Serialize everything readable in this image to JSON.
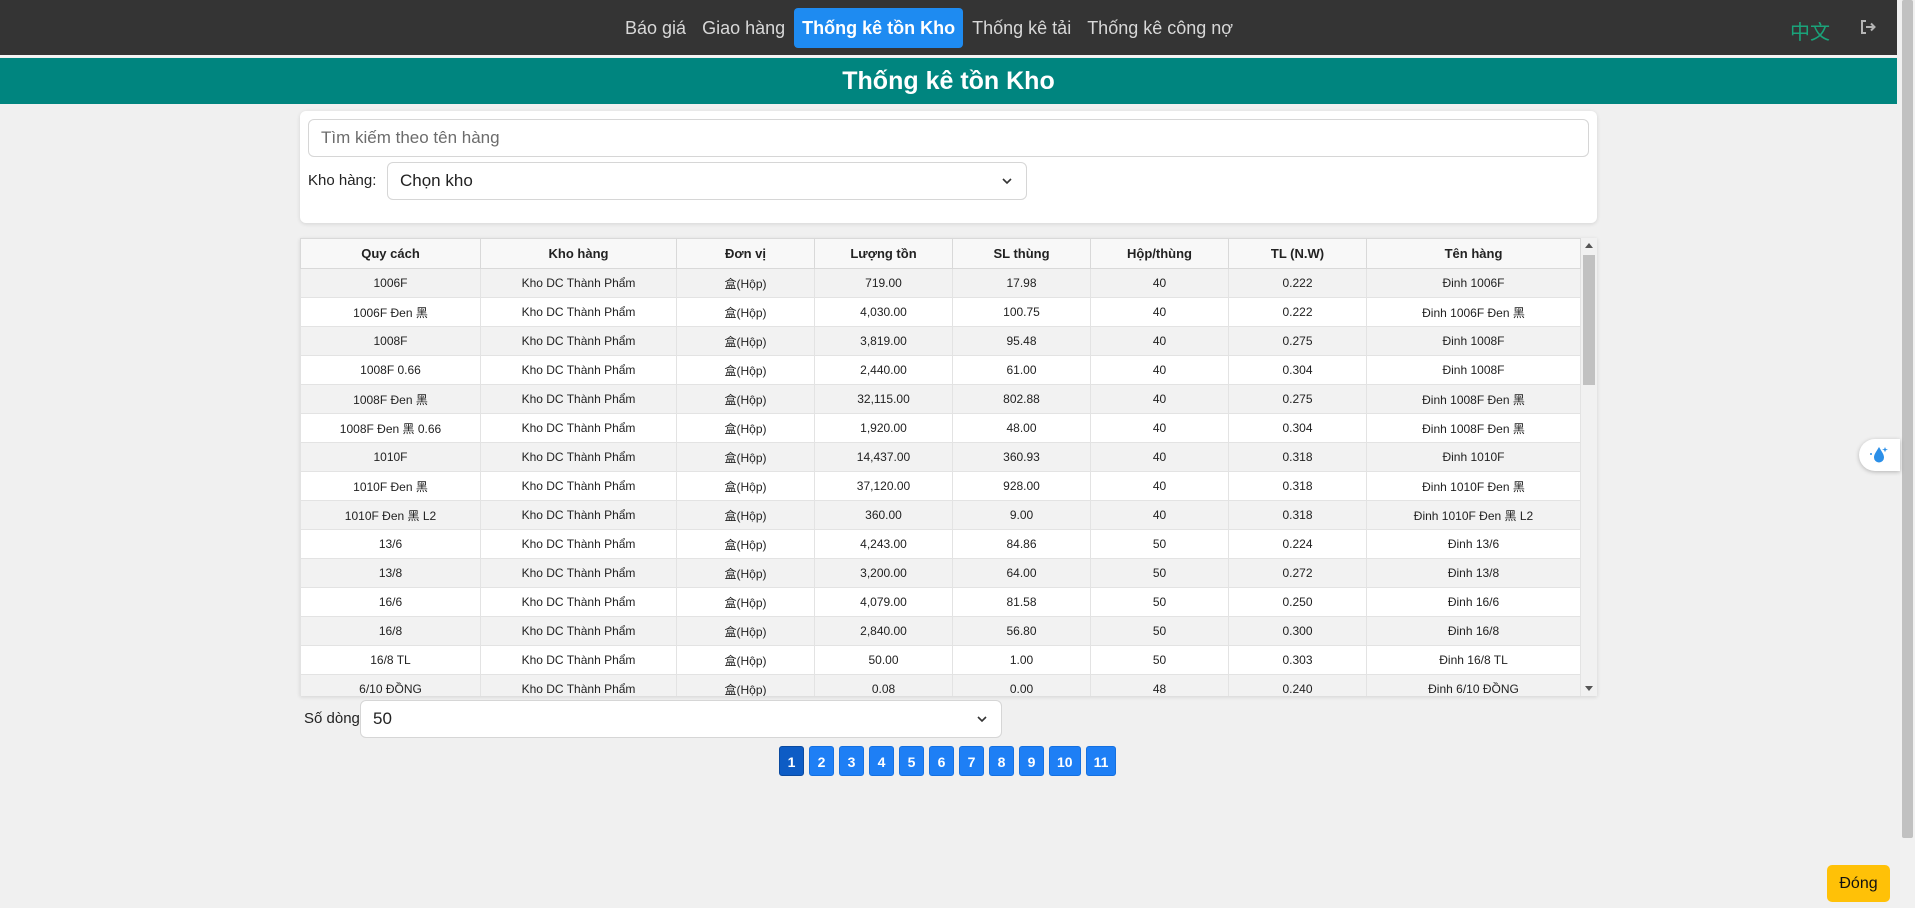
{
  "nav": {
    "items": [
      {
        "label": "Báo giá",
        "active": false
      },
      {
        "label": "Giao hàng",
        "active": false
      },
      {
        "label": "Thống kê tồn Kho",
        "active": true
      },
      {
        "label": "Thống kê tải",
        "active": false
      },
      {
        "label": "Thống kê công nợ",
        "active": false
      }
    ],
    "language": "中文",
    "logout_icon": "sign-out-icon"
  },
  "page_title": "Thống kê tồn Kho",
  "filters": {
    "search_placeholder": "Tìm kiếm theo tên hàng",
    "warehouse_label": "Kho hàng:",
    "warehouse_value": "Chọn kho"
  },
  "table": {
    "columns": [
      "Quy cách",
      "Kho hàng",
      "Đơn vị",
      "Lượng tồn",
      "SL thùng",
      "Hộp/thùng",
      "TL (N.W)",
      "Tên hàng"
    ],
    "rows": [
      [
        "1006F",
        "Kho DC Thành Phẩm",
        "盒(Hộp)",
        "719.00",
        "17.98",
        "40",
        "0.222",
        "Đinh 1006F"
      ],
      [
        "1006F Đen 黑",
        "Kho DC Thành Phẩm",
        "盒(Hộp)",
        "4,030.00",
        "100.75",
        "40",
        "0.222",
        "Đinh 1006F Đen 黑"
      ],
      [
        "1008F",
        "Kho DC Thành Phẩm",
        "盒(Hộp)",
        "3,819.00",
        "95.48",
        "40",
        "0.275",
        "Đinh 1008F"
      ],
      [
        "1008F 0.66",
        "Kho DC Thành Phẩm",
        "盒(Hộp)",
        "2,440.00",
        "61.00",
        "40",
        "0.304",
        "Đinh 1008F"
      ],
      [
        "1008F Đen 黑",
        "Kho DC Thành Phẩm",
        "盒(Hộp)",
        "32,115.00",
        "802.88",
        "40",
        "0.275",
        "Đinh 1008F Đen 黑"
      ],
      [
        "1008F Đen 黑 0.66",
        "Kho DC Thành Phẩm",
        "盒(Hộp)",
        "1,920.00",
        "48.00",
        "40",
        "0.304",
        "Đinh 1008F Đen 黑"
      ],
      [
        "1010F",
        "Kho DC Thành Phẩm",
        "盒(Hộp)",
        "14,437.00",
        "360.93",
        "40",
        "0.318",
        "Đinh 1010F"
      ],
      [
        "1010F Đen 黑",
        "Kho DC Thành Phẩm",
        "盒(Hộp)",
        "37,120.00",
        "928.00",
        "40",
        "0.318",
        "Đinh 1010F Đen 黑"
      ],
      [
        "1010F Đen 黑 L2",
        "Kho DC Thành Phẩm",
        "盒(Hộp)",
        "360.00",
        "9.00",
        "40",
        "0.318",
        "Đinh 1010F Đen 黑 L2"
      ],
      [
        "13/6",
        "Kho DC Thành Phẩm",
        "盒(Hộp)",
        "4,243.00",
        "84.86",
        "50",
        "0.224",
        "Đinh 13/6"
      ],
      [
        "13/8",
        "Kho DC Thành Phẩm",
        "盒(Hộp)",
        "3,200.00",
        "64.00",
        "50",
        "0.272",
        "Đinh 13/8"
      ],
      [
        "16/6",
        "Kho DC Thành Phẩm",
        "盒(Hộp)",
        "4,079.00",
        "81.58",
        "50",
        "0.250",
        "Đinh 16/6"
      ],
      [
        "16/8",
        "Kho DC Thành Phẩm",
        "盒(Hộp)",
        "2,840.00",
        "56.80",
        "50",
        "0.300",
        "Đinh 16/8"
      ],
      [
        "16/8 TL",
        "Kho DC Thành Phẩm",
        "盒(Hộp)",
        "50.00",
        "1.00",
        "50",
        "0.303",
        "Đinh 16/8 TL"
      ],
      [
        "6/10 ĐỒNG",
        "Kho DC Thành Phẩm",
        "盒(Hộp)",
        "0.08",
        "0.00",
        "48",
        "0.240",
        "Đinh 6/10 ĐỒNG"
      ]
    ]
  },
  "rows_per_page": {
    "label": "Số dòng:",
    "value": "50"
  },
  "pagination": {
    "pages": [
      "1",
      "2",
      "3",
      "4",
      "5",
      "6",
      "7",
      "8",
      "9",
      "10",
      "11"
    ],
    "current": "1"
  },
  "close_label": "Đóng",
  "colors": {
    "nav_bg": "#343434",
    "active_tab": "#1e8bf1",
    "title_bar": "#00857f",
    "page_button": "#1e7ff5",
    "close_button": "#ffc107",
    "language_link": "#1aa37a"
  }
}
